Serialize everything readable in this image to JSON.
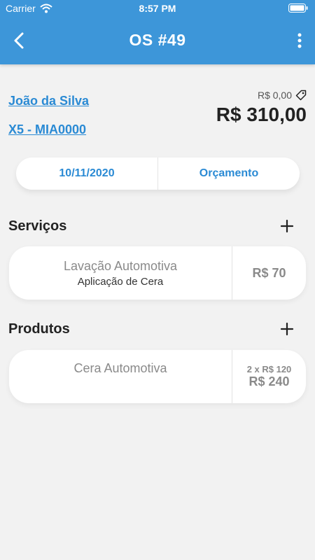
{
  "status_bar": {
    "carrier": "Carrier",
    "time": "8:57 PM"
  },
  "header": {
    "title": "OS #49"
  },
  "order": {
    "client": "João da Silva",
    "vehicle": "X5 - MIA0000",
    "discount": "R$ 0,00",
    "total": "R$ 310,00",
    "date": "10/11/2020",
    "status": "Orçamento"
  },
  "services": {
    "title": "Serviços",
    "items": [
      {
        "name": "Lavação Automotiva",
        "detail": "Aplicação de Cera",
        "price": "R$ 70"
      }
    ]
  },
  "products": {
    "title": "Produtos",
    "items": [
      {
        "name": "Cera Automotiva",
        "quantity": "2 x R$ 120",
        "price": "R$ 240"
      }
    ]
  },
  "colors": {
    "header": "#3d96d9",
    "link": "#2a8ad4",
    "background": "#f2f2f2"
  },
  "icons": [
    "wifi-icon",
    "battery-icon",
    "back-icon",
    "more-icon",
    "tag-icon",
    "plus-icon"
  ]
}
